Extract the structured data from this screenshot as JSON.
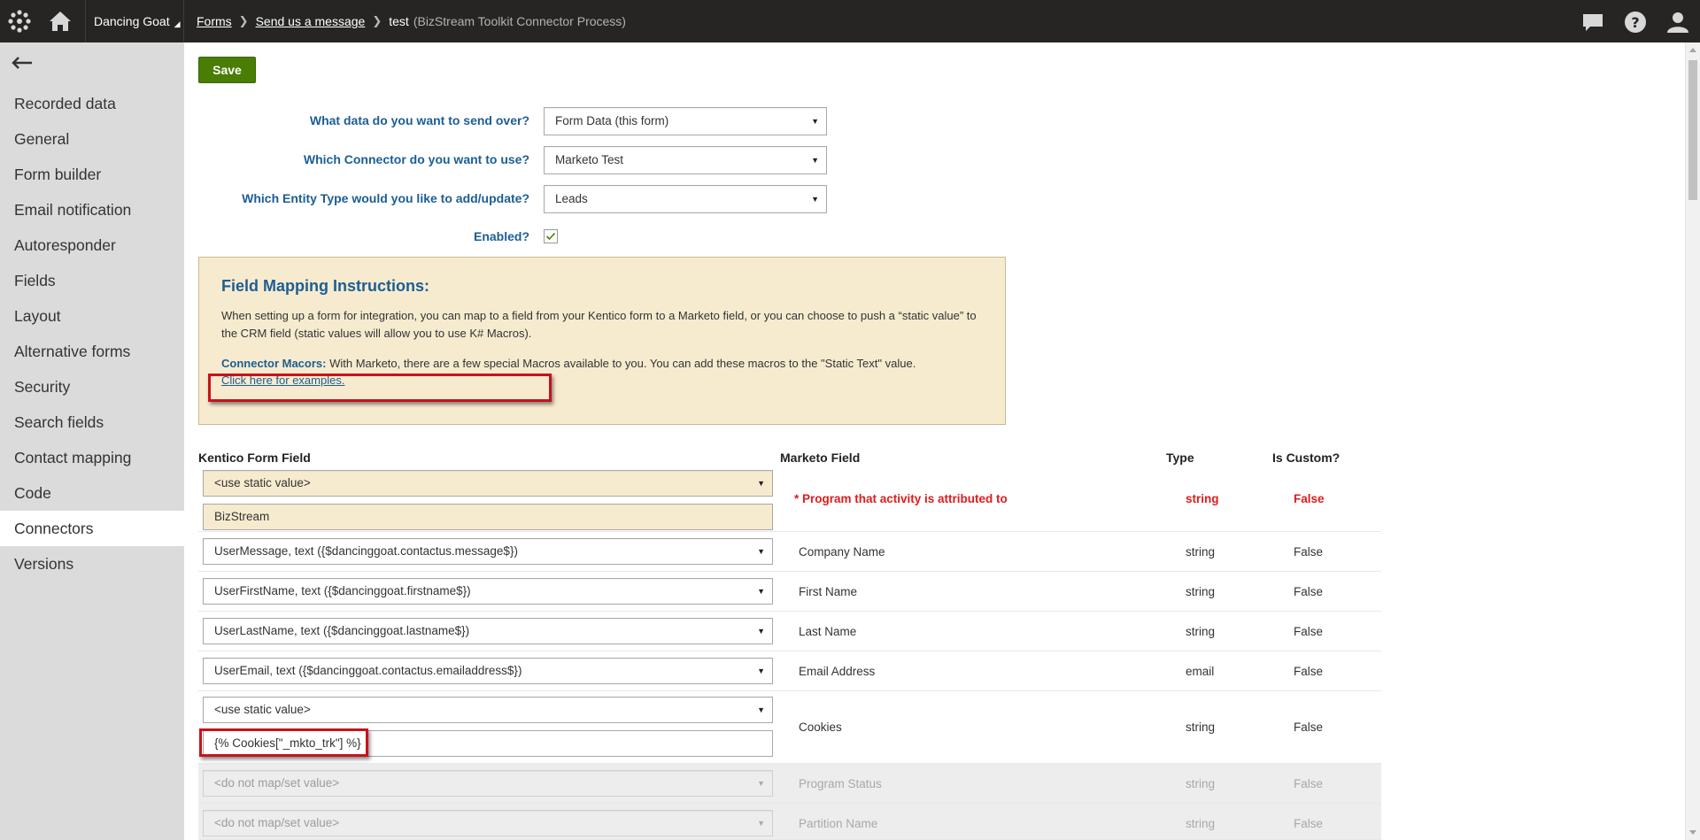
{
  "topbar": {
    "site": "Dancing Goat",
    "breadcrumb": [
      {
        "label": "Forms"
      },
      {
        "label": "Send us a message"
      }
    ],
    "current": "test",
    "current_sub": "(BizStream Toolkit Connector Process)"
  },
  "sidebar": {
    "items": [
      {
        "label": "Recorded data"
      },
      {
        "label": "General"
      },
      {
        "label": "Form builder"
      },
      {
        "label": "Email notification"
      },
      {
        "label": "Autoresponder"
      },
      {
        "label": "Fields"
      },
      {
        "label": "Layout"
      },
      {
        "label": "Alternative forms"
      },
      {
        "label": "Security"
      },
      {
        "label": "Search fields"
      },
      {
        "label": "Contact mapping"
      },
      {
        "label": "Code"
      },
      {
        "label": "Connectors",
        "active": true
      },
      {
        "label": "Versions"
      }
    ]
  },
  "toolbar": {
    "save_label": "Save"
  },
  "settings": {
    "data_label": "What data do you want to send over?",
    "data_value": "Form Data (this form)",
    "connector_label": "Which Connector do you want to use?",
    "connector_value": "Marketo Test",
    "entity_label": "Which Entity Type would you like to add/update?",
    "entity_value": "Leads",
    "enabled_label": "Enabled?",
    "enabled": true
  },
  "instructions": {
    "title": "Field Mapping Instructions:",
    "p1": "When setting up a form for integration, you can map to a field from your Kentico form to a Marketo field, or you can choose to push a “static value” to the CRM field (static values will allow you to use K# Macros).",
    "macros_label": "Connector Macors:",
    "macros_text": " With Marketo, there are a few special Macros available to you. You can add these macros to the \"Static Text\" value.",
    "examples_link": "Click here for examples."
  },
  "mapping": {
    "headers": {
      "kentico": "Kentico Form Field",
      "marketo": "Marketo Field",
      "type": "Type",
      "custom": "Is Custom?"
    },
    "rows": [
      {
        "select": "<use static value>",
        "static": "BizStream",
        "field": "* Program that activity is attributed to",
        "type": "string",
        "custom": "False"
      },
      {
        "select": "UserMessage, text ({$dancinggoat.contactus.message$})",
        "field": "Company Name",
        "type": "string",
        "custom": "False"
      },
      {
        "select": "UserFirstName, text ({$dancinggoat.firstname$})",
        "field": "First Name",
        "type": "string",
        "custom": "False"
      },
      {
        "select": "UserLastName, text ({$dancinggoat.lastname$})",
        "field": "Last Name",
        "type": "string",
        "custom": "False"
      },
      {
        "select": "UserEmail, text ({$dancinggoat.contactus.emailaddress$})",
        "field": "Email Address",
        "type": "email",
        "custom": "False"
      },
      {
        "select": "<use static value>",
        "static": "{% Cookies[\"_mkto_trk\"] %}",
        "field": "Cookies",
        "type": "string",
        "custom": "False"
      },
      {
        "select": "<do not map/set value>",
        "field": "Program Status",
        "type": "string",
        "custom": "False"
      },
      {
        "select": "<do not map/set value>",
        "field": "Partition Name",
        "type": "string",
        "custom": "False"
      }
    ]
  },
  "colors": {
    "topbar": "#262524",
    "sidebar": "#dbdbdb",
    "save": "#497d04",
    "label_blue": "#1c5e94",
    "instructions_bg": "#f7ebcf",
    "required_red": "#e01b1b",
    "highlight_red": "#c8121b"
  }
}
